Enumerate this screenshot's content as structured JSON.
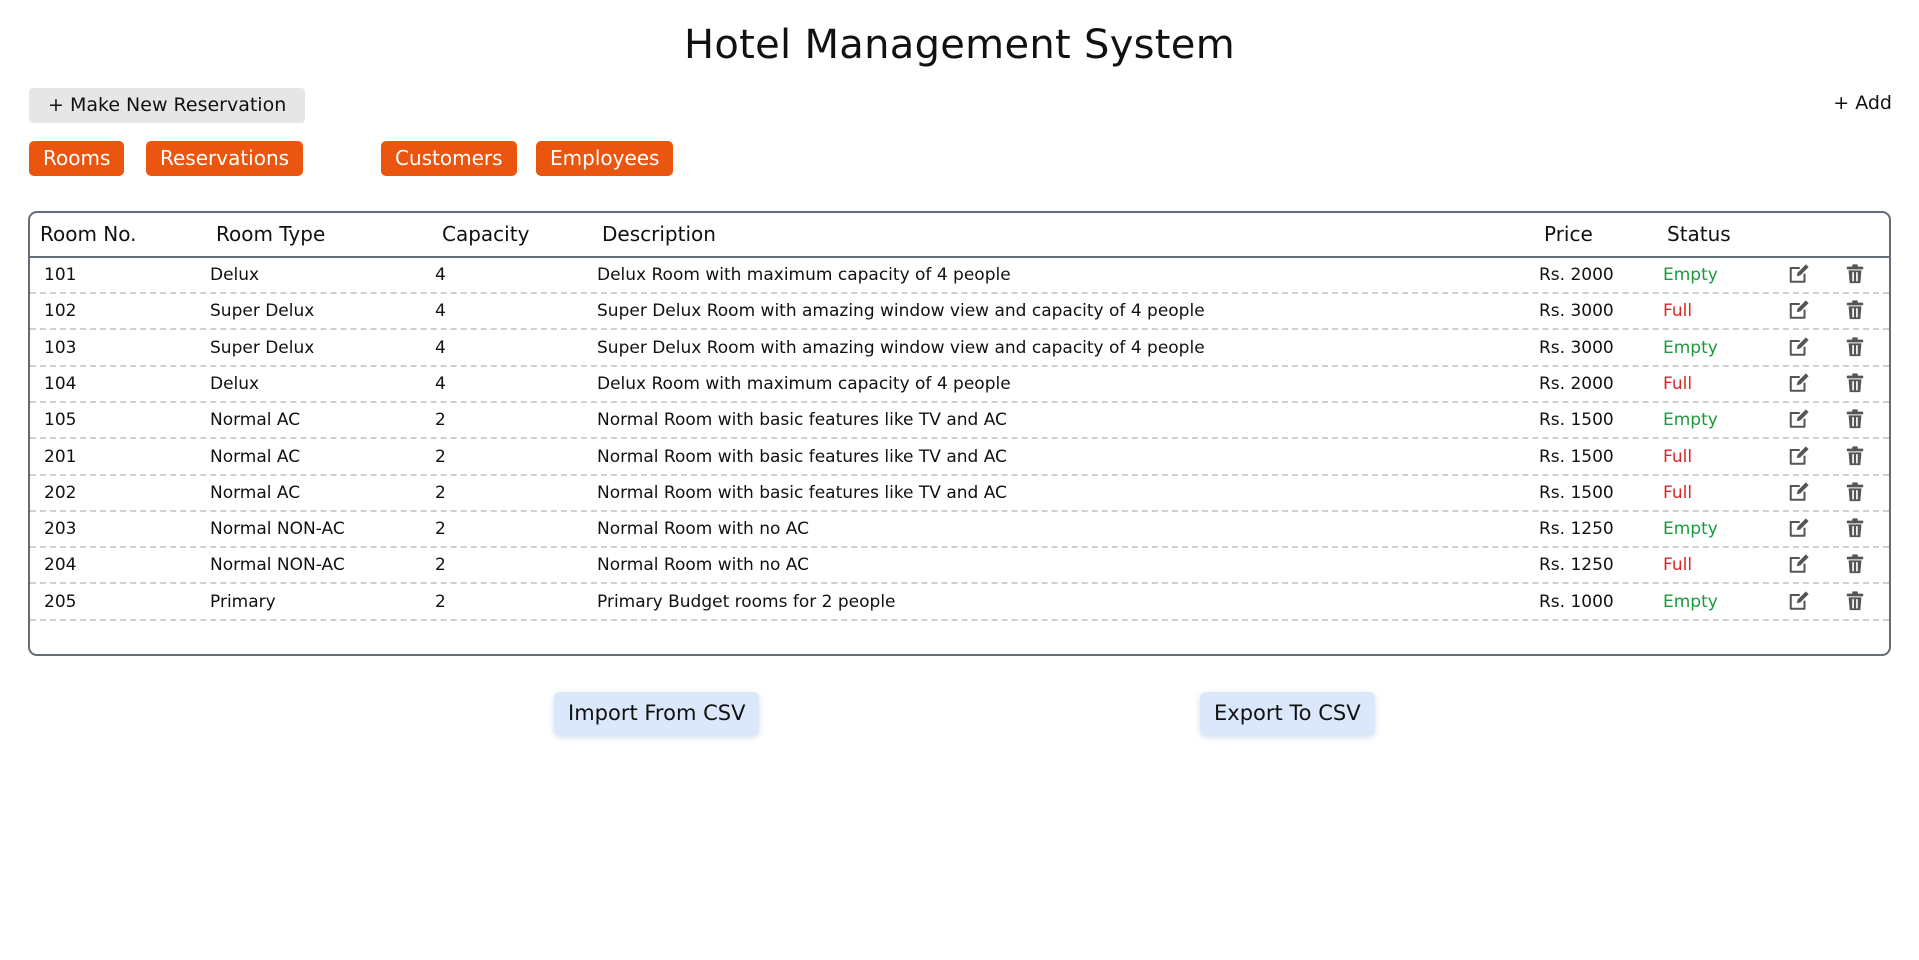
{
  "app": {
    "title": "Hotel Management System"
  },
  "toolbar": {
    "new_reservation_label": "+ Make New Reservation",
    "add_label": "+ Add"
  },
  "nav": {
    "tabs": [
      {
        "label": "Rooms"
      },
      {
        "label": "Reservations"
      },
      {
        "label": "Customers"
      },
      {
        "label": "Employees"
      }
    ]
  },
  "table": {
    "columns": [
      "Room No.",
      "Room Type",
      "Capacity",
      "Description",
      "Price",
      "Status"
    ],
    "rows": [
      {
        "room_no": "101",
        "room_type": "Delux",
        "capacity": "4",
        "description": "Delux Room with maximum capacity of 4 people",
        "price": "Rs. 2000",
        "status": "Empty"
      },
      {
        "room_no": "102",
        "room_type": "Super Delux",
        "capacity": "4",
        "description": "Super Delux Room with amazing window view and capacity of 4 people",
        "price": "Rs. 3000",
        "status": "Full"
      },
      {
        "room_no": "103",
        "room_type": "Super Delux",
        "capacity": "4",
        "description": "Super Delux Room with amazing window view and capacity of 4 people",
        "price": "Rs. 3000",
        "status": "Empty"
      },
      {
        "room_no": "104",
        "room_type": "Delux",
        "capacity": "4",
        "description": "Delux Room with maximum capacity of 4 people",
        "price": "Rs. 2000",
        "status": "Full"
      },
      {
        "room_no": "105",
        "room_type": "Normal AC",
        "capacity": "2",
        "description": "Normal Room with basic features like TV and AC",
        "price": "Rs. 1500",
        "status": "Empty"
      },
      {
        "room_no": "201",
        "room_type": "Normal AC",
        "capacity": "2",
        "description": "Normal Room with basic features like TV and AC",
        "price": "Rs. 1500",
        "status": "Full"
      },
      {
        "room_no": "202",
        "room_type": "Normal AC",
        "capacity": "2",
        "description": "Normal Room with basic features like TV and AC",
        "price": "Rs. 1500",
        "status": "Full"
      },
      {
        "room_no": "203",
        "room_type": "Normal NON-AC",
        "capacity": "2",
        "description": "Normal Room with no AC",
        "price": "Rs. 1250",
        "status": "Empty"
      },
      {
        "room_no": "204",
        "room_type": "Normal NON-AC",
        "capacity": "2",
        "description": "Normal Room with no AC",
        "price": "Rs. 1250",
        "status": "Full"
      },
      {
        "room_no": "205",
        "room_type": "Primary",
        "capacity": "2",
        "description": "Primary Budget rooms for 2 people",
        "price": "Rs. 1000",
        "status": "Empty"
      }
    ],
    "row_action_icons": [
      "edit-icon",
      "trash-icon"
    ]
  },
  "footer": {
    "import_label": "Import From CSV",
    "export_label": "Export To CSV"
  },
  "colors": {
    "accent": "#ea560f",
    "status_empty": "#1a9a3c",
    "status_full": "#d92626",
    "csv_button_bg": "#dbe8fb",
    "table_border": "#666c75"
  }
}
